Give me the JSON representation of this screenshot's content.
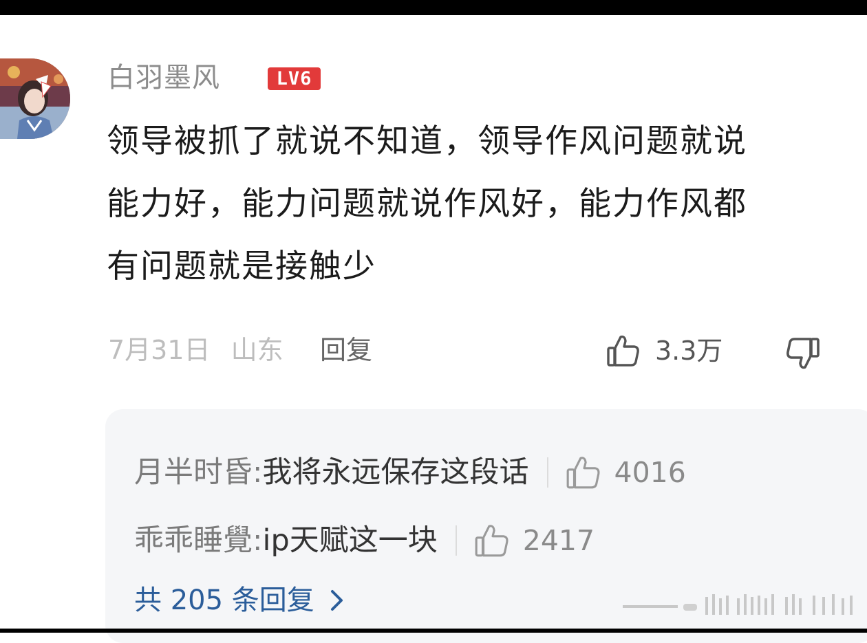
{
  "comment": {
    "username": "白羽墨风",
    "level": "LV6",
    "body_lines": [
      "领导被抓了就说不知道，领导作风问题就说",
      "能力好，能力问题就说作风好，能力作风都",
      "有问题就是接触少"
    ],
    "date": "7月31日",
    "location": "山东",
    "reply_label": "回复",
    "like_count": "3.3万"
  },
  "replies": [
    {
      "name": "月半时昏:",
      "text": " 我将永远保存这段话",
      "like_count": "4016"
    },
    {
      "name": "乖乖睡覺:",
      "text": " ip天赋这一块",
      "like_count": "2417"
    }
  ],
  "more_replies_label": "共 205 条回复",
  "icons": {
    "like": "thumbs-up-icon",
    "dislike": "thumbs-down-icon",
    "more": "chevron-right-icon"
  },
  "colors": {
    "level_badge": "#e23a3a",
    "link": "#2b5d9a",
    "reply_panel": "#f5f6f8"
  }
}
